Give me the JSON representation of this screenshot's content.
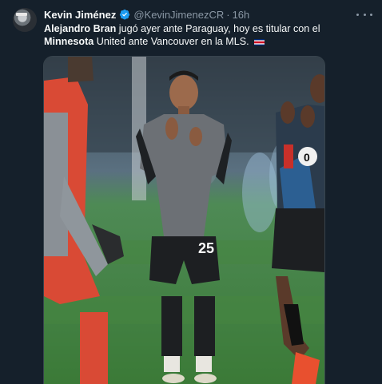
{
  "tweet": {
    "author_name": "Kevin Jiménez",
    "handle": "@KevinJimenezCR",
    "separator": "·",
    "time": "16h",
    "text_segments": [
      {
        "text": "Alejandro Bran",
        "bold": true
      },
      {
        "text": " jugó ayer ante Paraguay, hoy es titular con el ",
        "bold": false
      },
      {
        "text": "Minnesota",
        "bold": true
      },
      {
        "text": " United ante Vancouver en la MLS.",
        "bold": false
      }
    ],
    "flag_icon": "costa-rica-flag-icon",
    "verified_icon": "verified-badge-icon",
    "more_icon": "more-options-icon"
  },
  "media": {
    "jersey_number_left": "25",
    "jersey_number_right": "0",
    "colors": {
      "pitch": "#3f7d3a",
      "jersey": "#6c7075",
      "shorts": "#1d1f22",
      "keeper": "#d94a35",
      "accent_blue": "#2d6fb0"
    }
  },
  "colors": {
    "background": "#15202b",
    "text": "#f7f9f9",
    "muted": "#8b98a5",
    "verified": "#1d9bf0"
  }
}
